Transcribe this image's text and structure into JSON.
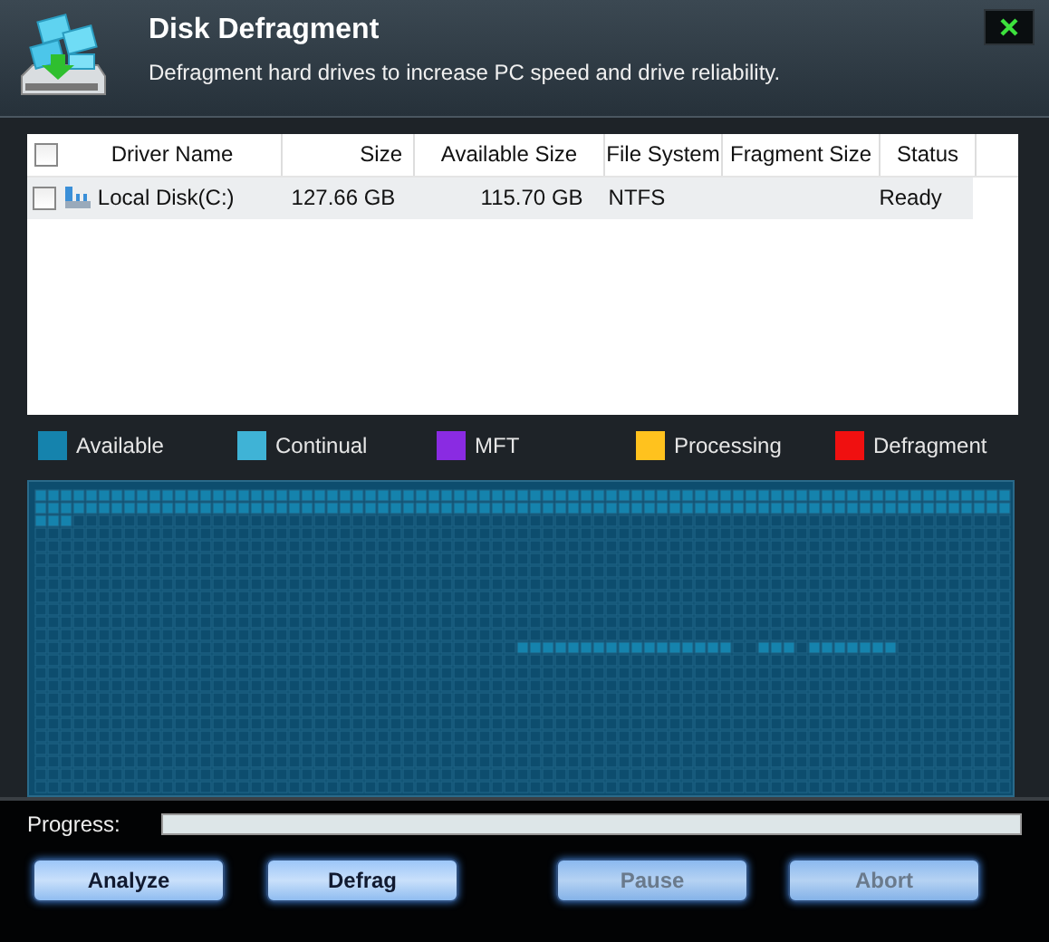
{
  "header": {
    "title": "Disk Defragment",
    "subtitle": "Defragment hard drives to increase PC speed and drive reliability."
  },
  "table": {
    "header_checked": false,
    "columns": [
      "Driver Name",
      "Size",
      "Available Size",
      "File System",
      "Fragment Size",
      "Status"
    ],
    "rows": [
      {
        "checked": false,
        "name": "Local Disk(C:)",
        "size": "127.66 GB",
        "available": "115.70 GB",
        "file_system": "NTFS",
        "status": "Ready"
      }
    ]
  },
  "legend": [
    {
      "label": "Available",
      "color": "#1583ad"
    },
    {
      "label": "Continual",
      "color": "#3fb3d6"
    },
    {
      "label": "MFT",
      "color": "#8a2be2"
    },
    {
      "label": "Processing",
      "color": "#ffc21e"
    },
    {
      "label": "Defragment",
      "color": "#f01010"
    }
  ],
  "progress": {
    "label": "Progress:",
    "level": 0
  },
  "buttons": [
    {
      "label": "Analyze",
      "disabled": false
    },
    {
      "label": "Defrag",
      "disabled": false
    },
    {
      "label": "Pause",
      "disabled": true
    },
    {
      "label": "Abort",
      "disabled": true
    }
  ]
}
